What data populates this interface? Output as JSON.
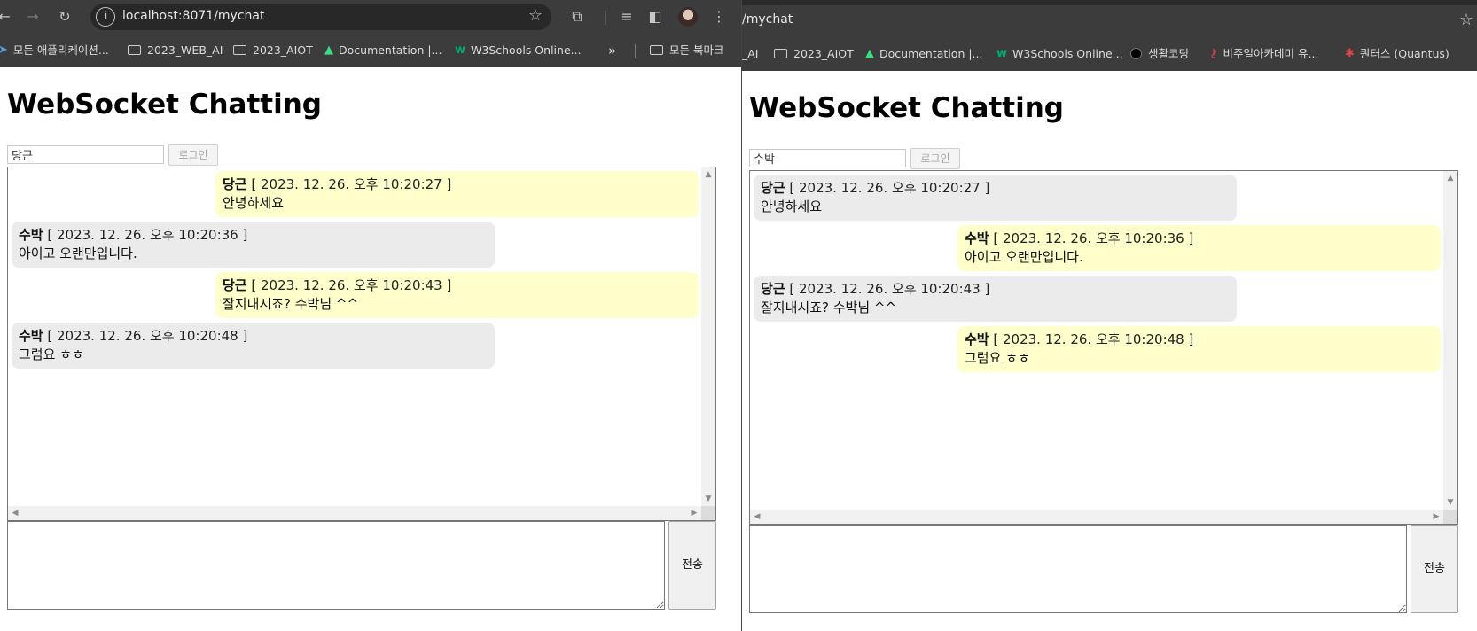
{
  "left_window": {
    "url": "localhost:8071/mychat",
    "bookmarks": [
      {
        "label": "모든 애플리케이션...",
        "icon": "app-icon"
      },
      {
        "label": "2023_WEB_AI",
        "icon": "folder-icon"
      },
      {
        "label": "2023_AIOT",
        "icon": "folder-icon"
      },
      {
        "label": "Documentation |...",
        "icon": "android-icon"
      },
      {
        "label": "W3Schools Online...",
        "icon": "w3schools-icon"
      }
    ],
    "bookmarks_overflow": "»",
    "all_bookmarks_label": "모든 북마크",
    "page": {
      "title": "WebSocket Chatting",
      "username_value": "당근",
      "login_label": "로그인",
      "send_label": "전송",
      "message_input_value": "",
      "messages": [
        {
          "sender": "당근",
          "timestamp": "[ 2023. 12. 26. 오후 10:20:27 ]",
          "text": "안녕하세요",
          "mine": true
        },
        {
          "sender": "수박",
          "timestamp": "[ 2023. 12. 26. 오후 10:20:36 ]",
          "text": "아이고 오랜만입니다.",
          "mine": false
        },
        {
          "sender": "당근",
          "timestamp": "[ 2023. 12. 26. 오후 10:20:43 ]",
          "text": "잘지내시죠? 수박님 ^^",
          "mine": true
        },
        {
          "sender": "수박",
          "timestamp": "[ 2023. 12. 26. 오후 10:20:48 ]",
          "text": "그럼요 ㅎㅎ",
          "mine": false
        }
      ]
    }
  },
  "right_window": {
    "url": "/mychat",
    "bookmarks": [
      {
        "label": "_AI",
        "icon": ""
      },
      {
        "label": "2023_AIOT",
        "icon": "folder-icon"
      },
      {
        "label": "Documentation |...",
        "icon": "android-icon"
      },
      {
        "label": "W3Schools Online...",
        "icon": "w3schools-icon"
      },
      {
        "label": "생활코딩",
        "icon": "circle-icon"
      },
      {
        "label": "비주얼아카데미 유...",
        "icon": "key-icon"
      },
      {
        "label": "퀀터스 (Quantus)",
        "icon": "quantus-icon"
      }
    ],
    "page": {
      "title": "WebSocket Chatting",
      "username_value": "수박",
      "login_label": "로그인",
      "send_label": "전송",
      "message_input_value": "",
      "messages": [
        {
          "sender": "당근",
          "timestamp": "[ 2023. 12. 26. 오후 10:20:27 ]",
          "text": "안녕하세요",
          "mine": false
        },
        {
          "sender": "수박",
          "timestamp": "[ 2023. 12. 26. 오후 10:20:36 ]",
          "text": "아이고 오랜만입니다.",
          "mine": true
        },
        {
          "sender": "당근",
          "timestamp": "[ 2023. 12. 26. 오후 10:20:43 ]",
          "text": "잘지내시죠? 수박님 ^^",
          "mine": false
        },
        {
          "sender": "수박",
          "timestamp": "[ 2023. 12. 26. 오후 10:20:48 ]",
          "text": "그럼요 ㅎㅎ",
          "mine": true
        }
      ]
    }
  },
  "colors": {
    "chrome_bg": "#3c3c3c",
    "omnibox_bg": "#282828",
    "mine_bubble": "#ffffcc",
    "other_bubble": "#ebebeb"
  }
}
